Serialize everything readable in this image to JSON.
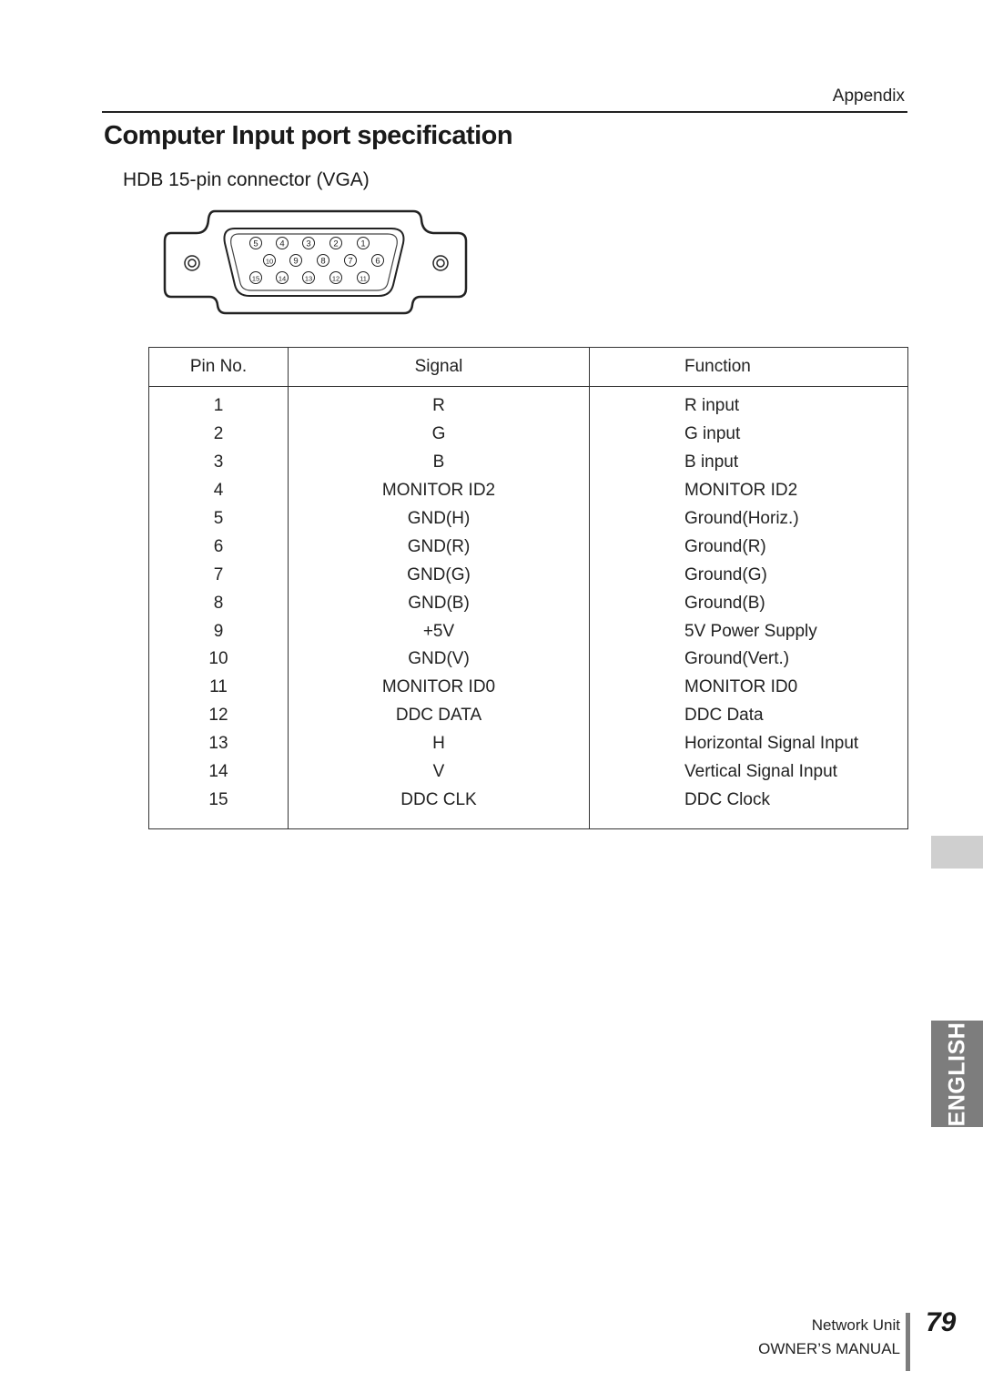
{
  "header": {
    "section": "Appendix"
  },
  "page": {
    "title": "Computer Input port specification",
    "subtitle": "HDB 15-pin connector (VGA)"
  },
  "connector": {
    "icon": "vga-connector-diagram",
    "rows": [
      [
        "5",
        "4",
        "3",
        "2",
        "1"
      ],
      [
        "10",
        "9",
        "8",
        "7",
        "6"
      ],
      [
        "15",
        "14",
        "13",
        "12",
        "11"
      ]
    ]
  },
  "table": {
    "headers": [
      "Pin No.",
      "Signal",
      "Function"
    ],
    "rows": [
      {
        "pin": "1",
        "signal": "R",
        "function": "R input"
      },
      {
        "pin": "2",
        "signal": "G",
        "function": "G input"
      },
      {
        "pin": "3",
        "signal": "B",
        "function": "B input"
      },
      {
        "pin": "4",
        "signal": "MONITOR ID2",
        "function": "MONITOR ID2"
      },
      {
        "pin": "5",
        "signal": "GND(H)",
        "function": "Ground(Horiz.)"
      },
      {
        "pin": "6",
        "signal": "GND(R)",
        "function": "Ground(R)"
      },
      {
        "pin": "7",
        "signal": "GND(G)",
        "function": "Ground(G)"
      },
      {
        "pin": "8",
        "signal": "GND(B)",
        "function": "Ground(B)"
      },
      {
        "pin": "9",
        "signal": "+5V",
        "function": "5V Power Supply"
      },
      {
        "pin": "10",
        "signal": "GND(V)",
        "function": "Ground(Vert.)"
      },
      {
        "pin": "11",
        "signal": "MONITOR ID0",
        "function": "MONITOR ID0"
      },
      {
        "pin": "12",
        "signal": "DDC DATA",
        "function": "DDC Data"
      },
      {
        "pin": "13",
        "signal": "H",
        "function": "Horizontal Signal Input"
      },
      {
        "pin": "14",
        "signal": "V",
        "function": "Vertical Signal Input"
      },
      {
        "pin": "15",
        "signal": "DDC CLK",
        "function": "DDC Clock"
      }
    ]
  },
  "side_tabs": {
    "language": "ENGLISH",
    "colors": {
      "tab_gray": "#cfcfcf",
      "tab_language": "#7d7d7d"
    }
  },
  "footer": {
    "product": "Network Unit",
    "manual": "OWNER’S MANUAL",
    "page_number": "79"
  }
}
